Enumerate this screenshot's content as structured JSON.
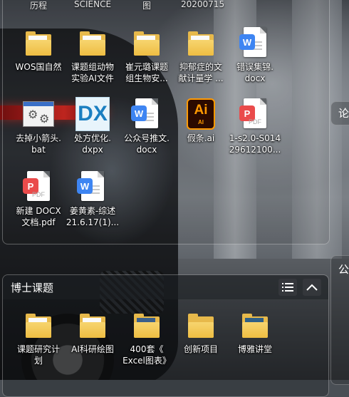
{
  "top_cut_labels": [
    "历程",
    "SCIENCE",
    "图",
    "20200715"
  ],
  "fence_top": {
    "items": [
      {
        "label": "WOS国自然",
        "icon": "folder-icon",
        "type": "folder"
      },
      {
        "label": "课题组动物\n实验AI文件",
        "icon": "folder-icon",
        "type": "folder"
      },
      {
        "label": "崔元璐课题\n组生物安...",
        "icon": "folder-icon",
        "type": "folder"
      },
      {
        "label": "抑郁症的文\n献计量学 ...",
        "icon": "folder-icon",
        "type": "folder"
      },
      {
        "label": "错误集锦.\ndocx",
        "icon": "word-icon",
        "type": "word"
      },
      {
        "label": "去掉小箭头.\nbat",
        "icon": "bat-icon",
        "type": "bat"
      },
      {
        "label": "处方优化.\ndxpx",
        "icon": "dx-icon",
        "type": "dx",
        "icon_text": "DX"
      },
      {
        "label": "公众号推文.\ndocx",
        "icon": "word-icon",
        "type": "word"
      },
      {
        "label": "假条.ai",
        "icon": "ai-icon",
        "type": "ai",
        "icon_text": "Ai",
        "icon_sub": "AI"
      },
      {
        "label": "1-s2.0-S014\n29612100...",
        "icon": "pdf-icon",
        "type": "pdf"
      },
      {
        "label": "新建 DOCX\n文档.pdf",
        "icon": "pdf-icon",
        "type": "pdf"
      },
      {
        "label": "姜黄素-综述\n21.6.17(1)...",
        "icon": "word-icon",
        "type": "word"
      }
    ]
  },
  "fence_bottom": {
    "title": "博士课题",
    "items": [
      {
        "label": "课题研究计\n划",
        "icon": "folder-icon"
      },
      {
        "label": "AI科研绘图",
        "icon": "folder-icon"
      },
      {
        "label": "400套《\nExcel图表》",
        "icon": "folder-icon"
      },
      {
        "label": "创新项目",
        "icon": "folder-icon"
      },
      {
        "label": "博雅讲堂",
        "icon": "folder-icon"
      }
    ]
  },
  "side_labels": {
    "upper": "论",
    "lower": "公"
  },
  "badges": {
    "word": "W",
    "pdf": "P",
    "pdf_sub": "PDF"
  },
  "colors": {
    "folder": "#e7b94b",
    "word": "#3e85f2",
    "pdf": "#ea4b4b",
    "ai": "#ff9a00"
  }
}
